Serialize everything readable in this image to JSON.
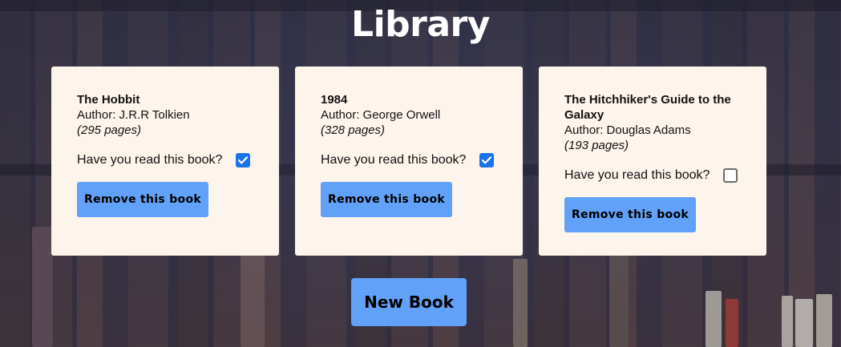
{
  "page": {
    "title": "Library"
  },
  "books": [
    {
      "title": "The Hobbit",
      "author": "Author: J.R.R Tolkien",
      "pages": "(295 pages)",
      "read_label": "Have you read this book?",
      "read": true,
      "remove_label": "Remove this book"
    },
    {
      "title": "1984",
      "author": "Author: George Orwell",
      "pages": "(328 pages)",
      "read_label": "Have you read this book?",
      "read": true,
      "remove_label": "Remove this book"
    },
    {
      "title": "The Hitchhiker's Guide to the Galaxy",
      "author": "Author: Douglas Adams",
      "pages": "(193 pages)",
      "read_label": "Have you read this book?",
      "read": false,
      "remove_label": "Remove this book"
    }
  ],
  "actions": {
    "new_book_label": "New Book"
  },
  "colors": {
    "card_bg": "#fdf4ec",
    "button_bg": "#61a1f7",
    "checkbox_checked": "#1a73e8",
    "title_text": "#ffffff"
  },
  "icons": {
    "checked": "checkmark-icon"
  }
}
